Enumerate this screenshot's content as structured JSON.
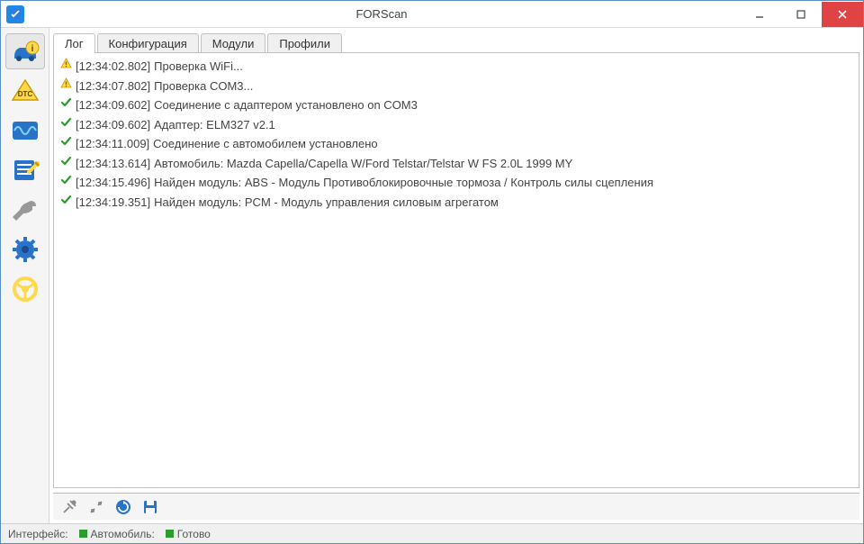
{
  "window": {
    "title": "FORScan"
  },
  "sidebar_icons": [
    "car-info",
    "dtc",
    "oscilloscope",
    "checklist",
    "wrench",
    "gear",
    "steering-wheel"
  ],
  "tabs": [
    "Лог",
    "Конфигурация",
    "Модули",
    "Профили"
  ],
  "active_tab": 0,
  "log": [
    {
      "icon": "warn",
      "time": "[12:34:02.802]",
      "text": "Проверка WiFi..."
    },
    {
      "icon": "warn",
      "time": "[12:34:07.802]",
      "text": "Проверка COM3..."
    },
    {
      "icon": "ok",
      "time": "[12:34:09.602]",
      "text": "Соединение с адаптером установлено on COM3"
    },
    {
      "icon": "ok",
      "time": "[12:34:09.602]",
      "text": "Адаптер:  ELM327 v2.1"
    },
    {
      "icon": "ok",
      "time": "[12:34:11.009]",
      "text": "Соединение с автомобилем установлено"
    },
    {
      "icon": "ok",
      "time": "[12:34:13.614]",
      "text": "Автомобиль: Mazda Capella/Capella W/Ford Telstar/Telstar W FS 2.0L 1999 MY"
    },
    {
      "icon": "ok",
      "time": "[12:34:15.496]",
      "text": "Найден модуль:  ABS - Модуль Противоблокировочные тормоза / Контроль силы сцепления"
    },
    {
      "icon": "ok",
      "time": "[12:34:19.351]",
      "text": "Найден модуль:  PCM - Модуль управления силовым агрегатом"
    }
  ],
  "bottom_buttons": [
    "connect",
    "disconnect",
    "refresh",
    "save"
  ],
  "status": {
    "interface_label": "Интерфейс:",
    "vehicle_label": "Автомобиль:",
    "ready_label": "Готово"
  }
}
